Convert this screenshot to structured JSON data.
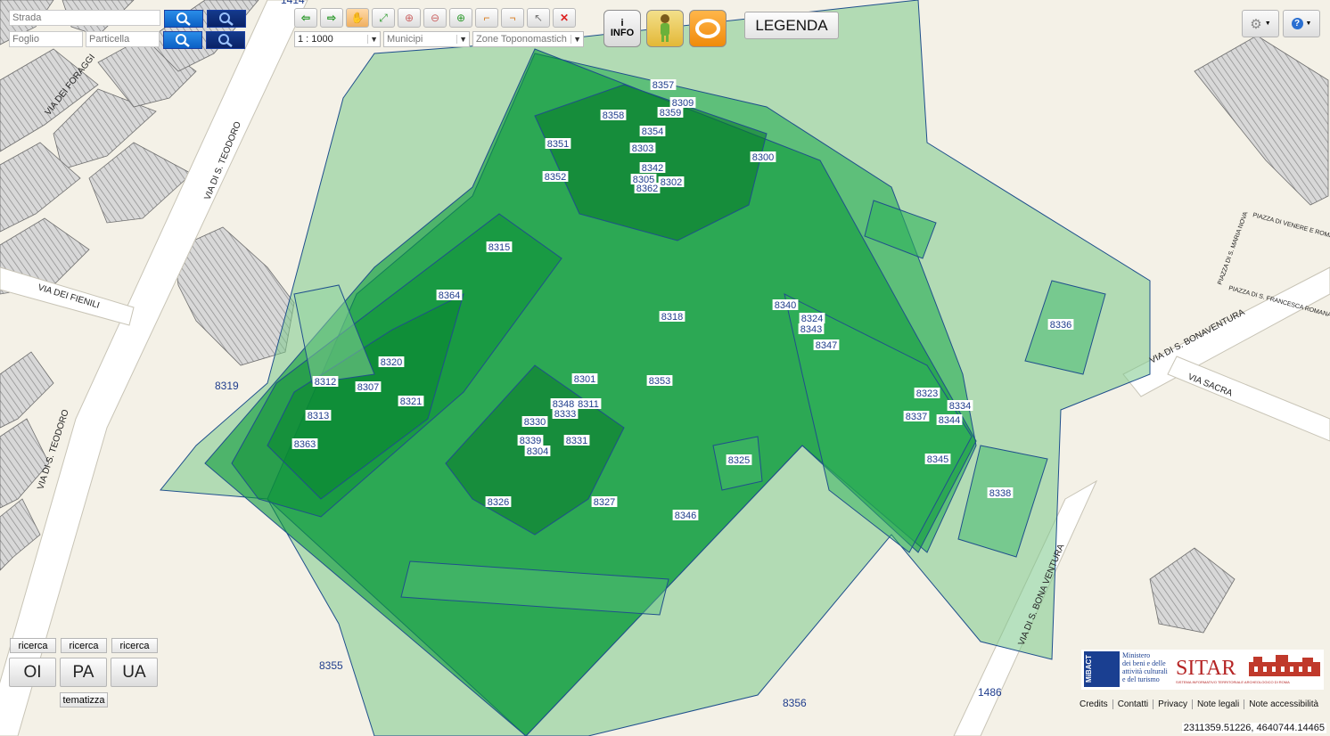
{
  "search": {
    "strada_placeholder": "Strada",
    "foglio_placeholder": "Foglio",
    "particella_placeholder": "Particella"
  },
  "toolbar": {
    "scale_value": "1 : 1000",
    "municipi_value": "Municipi",
    "zone_value": "Zone Toponomastich",
    "info_label_top": "i",
    "info_label_bottom": "INFO",
    "legend_label": "LEGENDA"
  },
  "streets": {
    "via_dei_foraggi": "VIA DEI FORAGGI",
    "via_s_teodoro_top": "VIA DI S. TEODORO",
    "via_dei_fienili": "VIA DEI FIENILI",
    "via_s_teodoro_bottom": "VIA DI S. TEODORO",
    "via_s_bonaventura_right": "VIA DI S. BONAVENTURA",
    "via_s_bonaventura_bottom": "VIA DI S. BONA VENTURA",
    "via_sacra": "VIA SACRA",
    "piazza_di_venere": "PIAZZA DI VENERE E ROMA",
    "piazza_s_maria_nova": "PIAZZA DI S. MARIA NOVA",
    "piazza_s_francesca": "PIAZZA DI S. FRANCESCA ROMANA"
  },
  "map_labels": [
    {
      "id": "l8357",
      "text": "8357"
    },
    {
      "id": "l8309",
      "text": "8309"
    },
    {
      "id": "l8359",
      "text": "8359"
    },
    {
      "id": "l8358",
      "text": "8358"
    },
    {
      "id": "l8354",
      "text": "8354"
    },
    {
      "id": "l8351",
      "text": "8351"
    },
    {
      "id": "l8303",
      "text": "8303"
    },
    {
      "id": "l8300",
      "text": "8300"
    },
    {
      "id": "l8342",
      "text": "8342"
    },
    {
      "id": "l8305",
      "text": "8305"
    },
    {
      "id": "l8302",
      "text": "8302"
    },
    {
      "id": "l8362",
      "text": "8362"
    },
    {
      "id": "l8352",
      "text": "8352"
    },
    {
      "id": "l8315",
      "text": "8315"
    },
    {
      "id": "l8364",
      "text": "8364"
    },
    {
      "id": "l8318",
      "text": "8318"
    },
    {
      "id": "l8340",
      "text": "8340"
    },
    {
      "id": "l8324",
      "text": "8324"
    },
    {
      "id": "l8343",
      "text": "8343"
    },
    {
      "id": "l8347",
      "text": "8347"
    },
    {
      "id": "l8336",
      "text": "8336"
    },
    {
      "id": "l8320",
      "text": "8320"
    },
    {
      "id": "l8312",
      "text": "8312"
    },
    {
      "id": "l8307",
      "text": "8307"
    },
    {
      "id": "l8321",
      "text": "8321"
    },
    {
      "id": "l8301",
      "text": "8301"
    },
    {
      "id": "l8353",
      "text": "8353"
    },
    {
      "id": "l8348",
      "text": "8348"
    },
    {
      "id": "l8311",
      "text": "8311"
    },
    {
      "id": "l8333",
      "text": "8333"
    },
    {
      "id": "l8330",
      "text": "8330"
    },
    {
      "id": "l8313",
      "text": "8313"
    },
    {
      "id": "l8323",
      "text": "8323"
    },
    {
      "id": "l8334",
      "text": "8334"
    },
    {
      "id": "l8337",
      "text": "8337"
    },
    {
      "id": "l8344",
      "text": "8344"
    },
    {
      "id": "l8339",
      "text": "8339"
    },
    {
      "id": "l8331",
      "text": "8331"
    },
    {
      "id": "l8304",
      "text": "8304"
    },
    {
      "id": "l8363",
      "text": "8363"
    },
    {
      "id": "l8345",
      "text": "8345"
    },
    {
      "id": "l8325",
      "text": "8325"
    },
    {
      "id": "l8338",
      "text": "8338"
    },
    {
      "id": "l8326",
      "text": "8326"
    },
    {
      "id": "l8327",
      "text": "8327"
    },
    {
      "id": "l8346",
      "text": "8346"
    }
  ],
  "plain_labels": {
    "p8319": "8319",
    "p8355": "8355",
    "p8356": "8356",
    "p1486": "1486",
    "p1414": "1414"
  },
  "left_panel": {
    "ricerca_1": "ricerca",
    "ricerca_2": "ricerca",
    "ricerca_3": "ricerca",
    "oi_label": "OI",
    "pa_label": "PA",
    "ua_label": "UA",
    "tematizza_label": "tematizza"
  },
  "logo": {
    "mibac_lines": [
      "Ministero",
      "dei beni e delle",
      "attività culturali",
      "e del turismo"
    ],
    "mibac_side": "MiBACT",
    "sitar_title": "SITAR",
    "sitar_subtitle": "SISTEMA INFORMATIVO TERRITORIALE ARCHEOLOGICO DI ROMA"
  },
  "footer": {
    "credits": "Credits",
    "contatti": "Contatti",
    "privacy": "Privacy",
    "note_legali": "Note legali",
    "note_accessibilita": "Note accessibilità",
    "coordinates": "2311359.51226, 4640744.14465"
  },
  "colors": {
    "map_bg": "#f4f1e7",
    "polygon_fill": "#0c9a3a",
    "polygon_stroke": "#1f4f8c",
    "building_hatch": "#a9a9a9",
    "road": "#ffffff"
  }
}
